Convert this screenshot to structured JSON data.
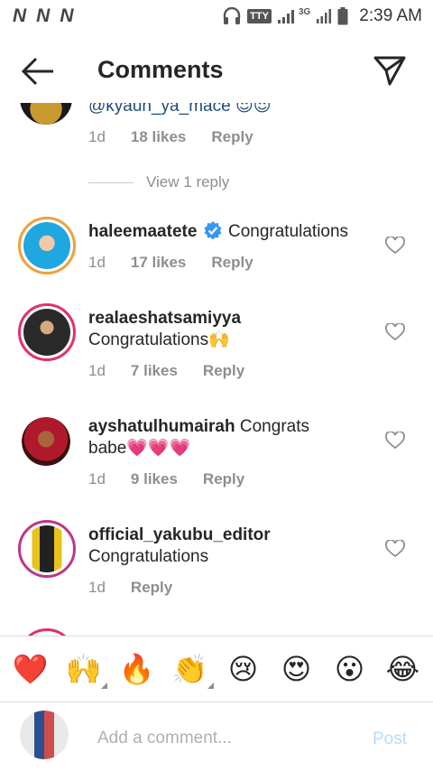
{
  "status_bar": {
    "notif_icons": [
      "N",
      "N",
      "N"
    ],
    "tty": "TTY",
    "network": "3G",
    "time": "2:39 AM"
  },
  "header": {
    "title": "Comments",
    "back_icon": "arrow-left-icon",
    "share_icon": "direct-send-icon"
  },
  "comments": [
    {
      "username": "@kyaun_ya_mace",
      "text": "",
      "time": "1d",
      "likes": "18 likes",
      "reply": "Reply",
      "partial": true
    },
    {
      "view_replies": "View 1 reply"
    },
    {
      "username": "haleemaatete",
      "verified": true,
      "text": "Congratulations",
      "time": "1d",
      "likes": "17 likes",
      "reply": "Reply",
      "avatar_color": "#1fa7e0"
    },
    {
      "username": "realaeshatsamiyya",
      "text": "Congratulations🙌",
      "time": "1d",
      "likes": "7 likes",
      "reply": "Reply",
      "avatar_color": "#2a2a2a"
    },
    {
      "username": "ayshatulhumairah",
      "text_inline": "Congrats",
      "text": "babe💗💗💗",
      "time": "1d",
      "likes": "9 likes",
      "reply": "Reply",
      "avatar_color": "#b0192c"
    },
    {
      "username": "official_yakubu_editor",
      "text": "Congratulations",
      "time": "1d",
      "likes": "",
      "reply": "Reply",
      "avatar_color": "#e8c41a"
    }
  ],
  "emoji_bar": [
    "❤️",
    "🙌",
    "🔥",
    "👏",
    "😢",
    "😍",
    "😮",
    "😂"
  ],
  "composer": {
    "placeholder": "Add a comment...",
    "post_label": "Post"
  },
  "colors": {
    "accent_ring": "#e1306c",
    "verified_blue": "#3897f0",
    "post_disabled": "#b3dbff",
    "secondary_text": "#8e8e8e"
  }
}
